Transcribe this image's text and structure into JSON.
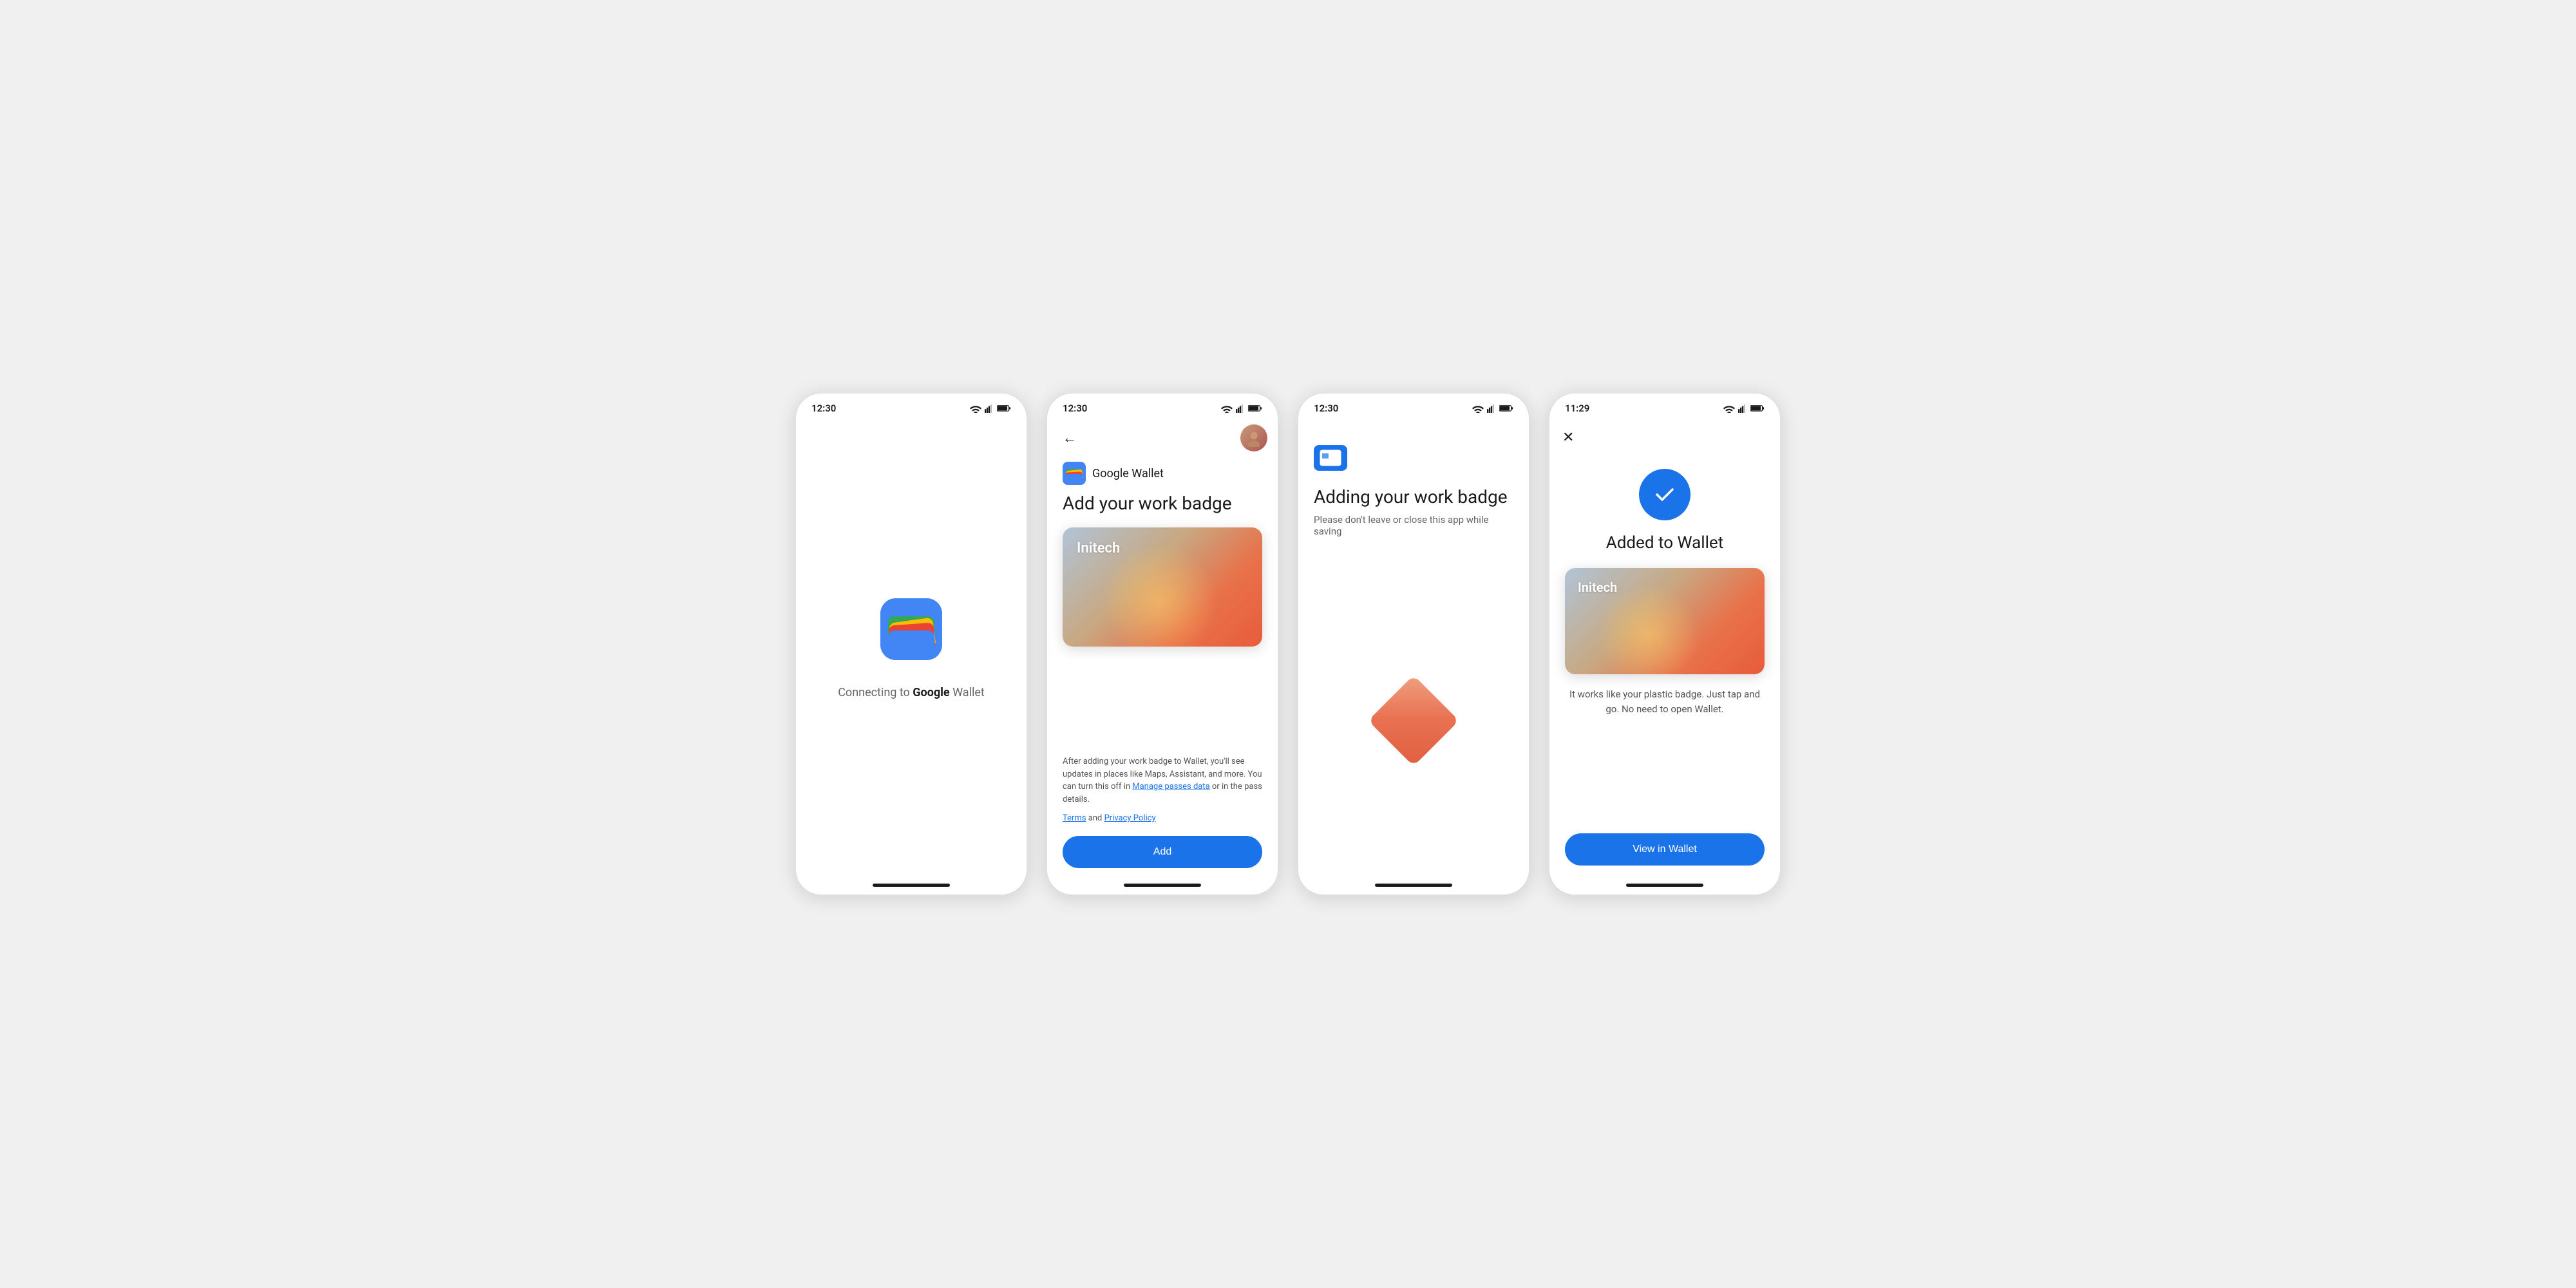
{
  "screens": [
    {
      "id": "screen1",
      "status_time": "12:30",
      "connecting_text_prefix": "Connecting to ",
      "connecting_text_bold": "Google",
      "connecting_text_suffix": " Wallet"
    },
    {
      "id": "screen2",
      "status_time": "12:30",
      "brand_name": "Google Wallet",
      "page_title": "Add your work badge",
      "badge_label": "Initech",
      "footer_text": "After adding your work badge to Wallet, you'll see updates in places like Maps, Assistant, and more. You can turn this off in ",
      "footer_link_text": "Manage passes data",
      "footer_text2": " or in the pass details.",
      "terms_text": " and ",
      "terms_link": "Terms",
      "privacy_link": "Privacy Policy",
      "add_button_label": "Add"
    },
    {
      "id": "screen3",
      "status_time": "12:30",
      "adding_title": "Adding your work badge",
      "adding_subtitle": "Please don't leave or close this app while saving"
    },
    {
      "id": "screen4",
      "status_time": "11:29",
      "added_title": "Added to Wallet",
      "badge_label": "Initech",
      "description": "It works like your plastic badge. Just tap and go. No need to open Wallet.",
      "view_button_label": "View in Wallet"
    }
  ]
}
